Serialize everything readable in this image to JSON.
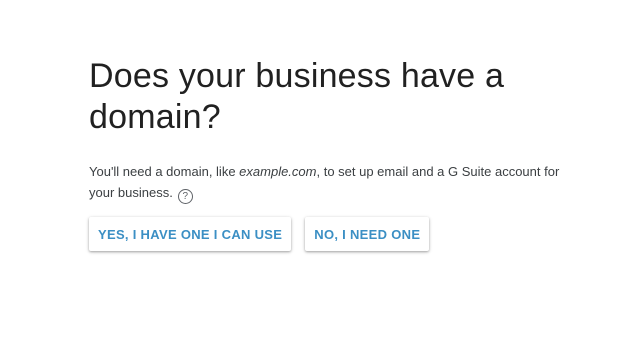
{
  "heading": {
    "title": "Does your business have a domain?"
  },
  "description": {
    "text_before": "You'll need a domain, like ",
    "example": "example.com",
    "text_after": ", to set up email and a G Suite account for your business.",
    "help_glyph": "?",
    "help_icon": "help-circle-icon"
  },
  "actions": {
    "yes_label": "YES, I HAVE ONE I CAN USE",
    "no_label": "NO, I NEED ONE"
  },
  "colors": {
    "accent": "#3b8fc4",
    "text": "#212121"
  }
}
